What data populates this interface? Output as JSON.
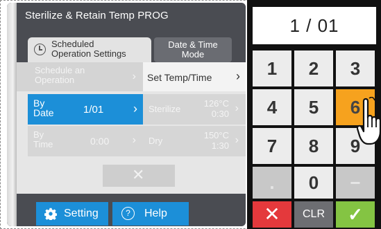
{
  "header": {
    "title": "Sterilize & Retain Temp PROG"
  },
  "tabs": {
    "scheduled": [
      "Scheduled",
      "Operation Settings"
    ],
    "date_time_mode": [
      "Date & Time",
      "Mode"
    ]
  },
  "menu": {
    "schedule_operation": [
      "Schedule an",
      "Operation"
    ],
    "set_temp_time": "Set Temp/Time",
    "by_date": {
      "label": [
        "By",
        "Date"
      ],
      "value": "1/01"
    },
    "by_time": {
      "label": [
        "By",
        "Time"
      ],
      "value": "0:00"
    },
    "sterilize": {
      "label": "Sterilize",
      "temp": "126°C",
      "time": "0:30"
    },
    "dry": {
      "label": "Dry",
      "temp": "150°C",
      "time": "1:30"
    },
    "cancel_symbol": "✕",
    "chevron": "›"
  },
  "footer": {
    "setting_label": "Setting",
    "help_label": "Help",
    "help_symbol": "?"
  },
  "keypad": {
    "display": "1 / 01",
    "keys": {
      "k1": "1",
      "k2": "2",
      "k3": "3",
      "k4": "4",
      "k5": "5",
      "k6": "6",
      "k7": "7",
      "k8": "8",
      "k9": "9",
      "dot": ".",
      "k0": "0",
      "minus": "−",
      "cancel": "✕",
      "clr": "CLR",
      "ok": "✓"
    },
    "selected_key": "6"
  },
  "colors": {
    "panel": "#4a4c52",
    "accent_blue": "#1c8fd8",
    "selected_orange": "#f6a21e",
    "cancel_red": "#e4393c",
    "ok_green": "#84c443",
    "clr_gray": "#6d6e72"
  },
  "icons": {
    "clock": "clock-icon",
    "gear": "gear-icon",
    "help": "help-circle-icon",
    "hand": "pointing-hand-icon"
  }
}
